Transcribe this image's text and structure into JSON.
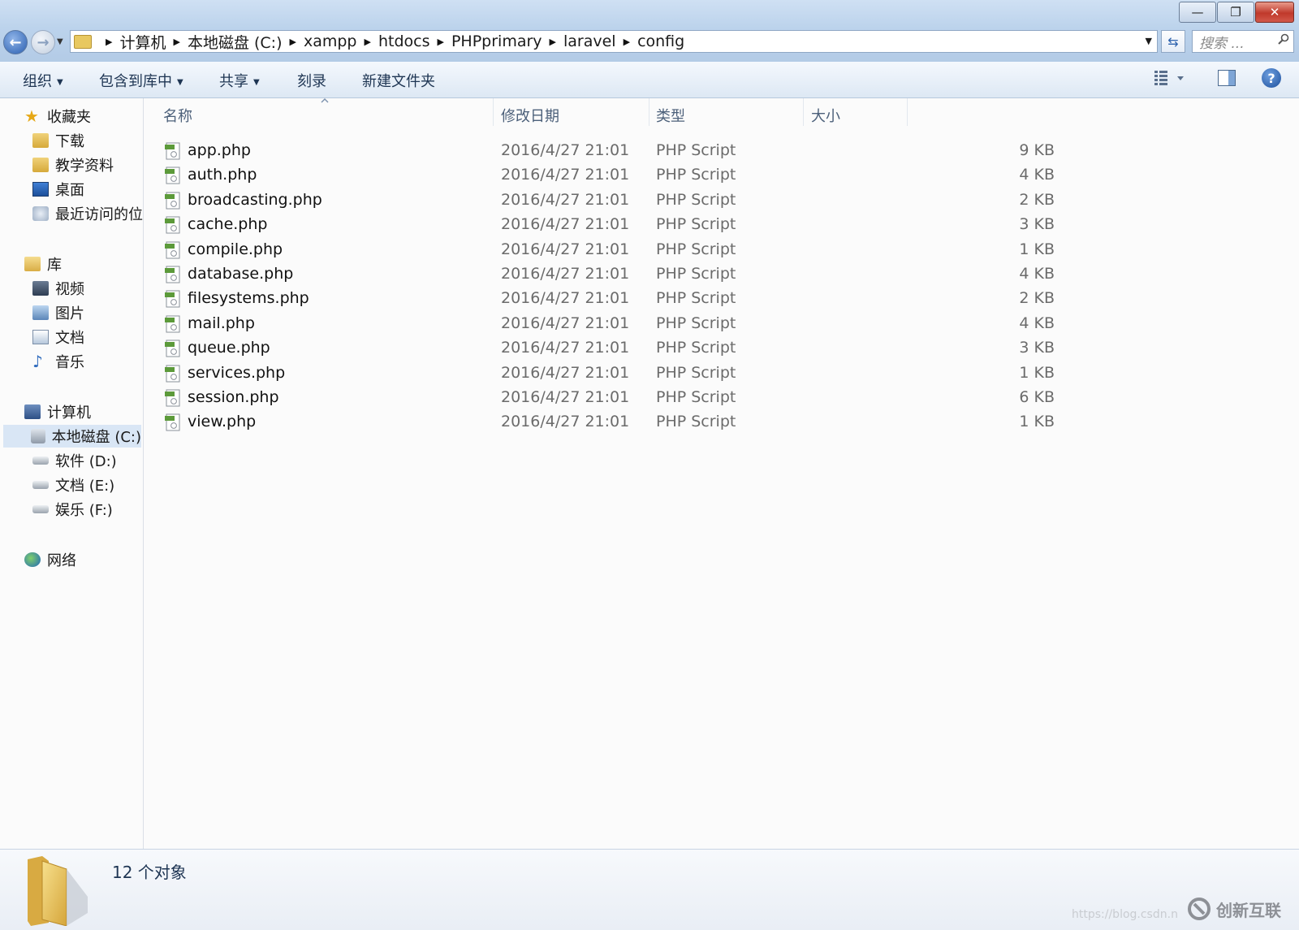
{
  "window": {
    "controls": {
      "minimize": "—",
      "maximize": "❐",
      "close": "✕"
    }
  },
  "address": {
    "crumbs": [
      "计算机",
      "本地磁盘 (C:)",
      "xampp",
      "htdocs",
      "PHPprimary",
      "laravel",
      "config"
    ],
    "search_placeholder": "搜索 ..."
  },
  "toolbar": {
    "organize": "组织",
    "include_in_library": "包含到库中",
    "share": "共享",
    "burn": "刻录",
    "new_folder": "新建文件夹"
  },
  "sidebar": {
    "favorites": {
      "title": "收藏夹",
      "items": [
        "下载",
        "教学资料",
        "桌面",
        "最近访问的位"
      ]
    },
    "libraries": {
      "title": "库",
      "items": [
        "视频",
        "图片",
        "文档",
        "音乐"
      ]
    },
    "computer": {
      "title": "计算机",
      "items": [
        "本地磁盘 (C:)",
        "软件 (D:)",
        "文档 (E:)",
        "娱乐 (F:)"
      ]
    },
    "network": {
      "title": "网络"
    }
  },
  "columns": {
    "name": "名称",
    "date": "修改日期",
    "type": "类型",
    "size": "大小"
  },
  "files": [
    {
      "name": "app.php",
      "date": "2016/4/27 21:01",
      "type": "PHP Script",
      "size": "9 KB"
    },
    {
      "name": "auth.php",
      "date": "2016/4/27 21:01",
      "type": "PHP Script",
      "size": "4 KB"
    },
    {
      "name": "broadcasting.php",
      "date": "2016/4/27 21:01",
      "type": "PHP Script",
      "size": "2 KB"
    },
    {
      "name": "cache.php",
      "date": "2016/4/27 21:01",
      "type": "PHP Script",
      "size": "3 KB"
    },
    {
      "name": "compile.php",
      "date": "2016/4/27 21:01",
      "type": "PHP Script",
      "size": "1 KB"
    },
    {
      "name": "database.php",
      "date": "2016/4/27 21:01",
      "type": "PHP Script",
      "size": "4 KB"
    },
    {
      "name": "filesystems.php",
      "date": "2016/4/27 21:01",
      "type": "PHP Script",
      "size": "2 KB"
    },
    {
      "name": "mail.php",
      "date": "2016/4/27 21:01",
      "type": "PHP Script",
      "size": "4 KB"
    },
    {
      "name": "queue.php",
      "date": "2016/4/27 21:01",
      "type": "PHP Script",
      "size": "3 KB"
    },
    {
      "name": "services.php",
      "date": "2016/4/27 21:01",
      "type": "PHP Script",
      "size": "1 KB"
    },
    {
      "name": "session.php",
      "date": "2016/4/27 21:01",
      "type": "PHP Script",
      "size": "6 KB"
    },
    {
      "name": "view.php",
      "date": "2016/4/27 21:01",
      "type": "PHP Script",
      "size": "1 KB"
    }
  ],
  "details": {
    "count": "12 个对象"
  },
  "watermark": {
    "url": "https://blog.csdn.n",
    "brand": "创新互联"
  },
  "colors": {
    "titlebar": "#bcd3ec",
    "close_button": "#c0392b",
    "selection": "#d9e6f5",
    "folder": "#e8c860"
  }
}
